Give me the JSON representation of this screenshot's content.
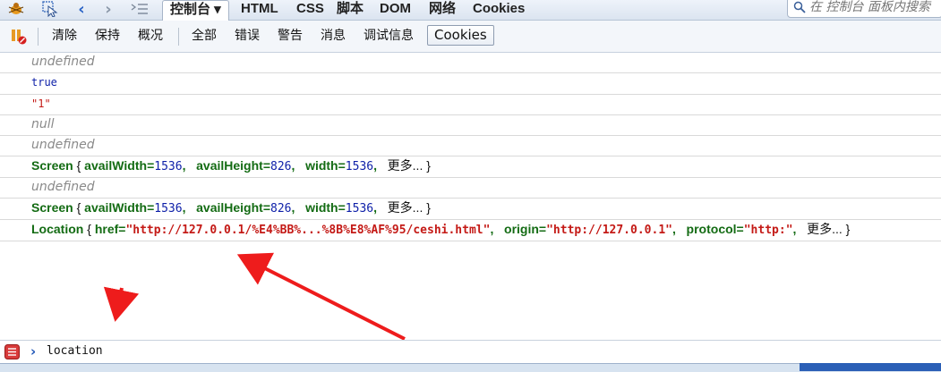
{
  "tabs": [
    {
      "label": "控制台 ▾",
      "active": true
    },
    {
      "label": "HTML",
      "active": false
    },
    {
      "label": "CSS",
      "active": false
    },
    {
      "label": "脚本",
      "active": false
    },
    {
      "label": "DOM",
      "active": false
    },
    {
      "label": "网络",
      "active": false
    },
    {
      "label": "Cookies",
      "active": false
    }
  ],
  "search": {
    "placeholder": "在 控制台 面板内搜索"
  },
  "toolbar": {
    "clear": "清除",
    "persist": "保持",
    "profile": "概况",
    "all": "全部",
    "errors": "错误",
    "warnings": "警告",
    "info": "消息",
    "debug": "调试信息",
    "cookies": "Cookies"
  },
  "console": {
    "rows": [
      {
        "type": "undefined",
        "text": "undefined"
      },
      {
        "type": "bool",
        "text": "true"
      },
      {
        "type": "string",
        "text": "\"1\""
      },
      {
        "type": "undefined",
        "text": "null"
      },
      {
        "type": "undefined",
        "text": "undefined"
      },
      {
        "type": "object",
        "name": "Screen",
        "props": [
          {
            "key": "availWidth",
            "val": "1536",
            "kind": "num"
          },
          {
            "key": "availHeight",
            "val": "826",
            "kind": "num"
          },
          {
            "key": "width",
            "val": "1536",
            "kind": "num"
          }
        ],
        "more": "更多..."
      },
      {
        "type": "undefined",
        "text": "undefined"
      },
      {
        "type": "object",
        "name": "Screen",
        "props": [
          {
            "key": "availWidth",
            "val": "1536",
            "kind": "num"
          },
          {
            "key": "availHeight",
            "val": "826",
            "kind": "num"
          },
          {
            "key": "width",
            "val": "1536",
            "kind": "num"
          }
        ],
        "more": "更多..."
      },
      {
        "type": "object",
        "name": "Location",
        "props": [
          {
            "key": "href",
            "val": "\"http://127.0.0.1/%E4%BB%...%8B%E8%AF%95/ceshi.html\"",
            "kind": "str"
          },
          {
            "key": "origin",
            "val": "\"http://127.0.0.1\"",
            "kind": "str"
          },
          {
            "key": "protocol",
            "val": "\"http:\"",
            "kind": "str"
          }
        ],
        "more": "更多..."
      }
    ]
  },
  "command": {
    "value": "location"
  },
  "colors": {
    "arrow": "#ee1c1c",
    "object": "#136b13",
    "string": "#c41a16",
    "number": "#0d1fa8"
  }
}
